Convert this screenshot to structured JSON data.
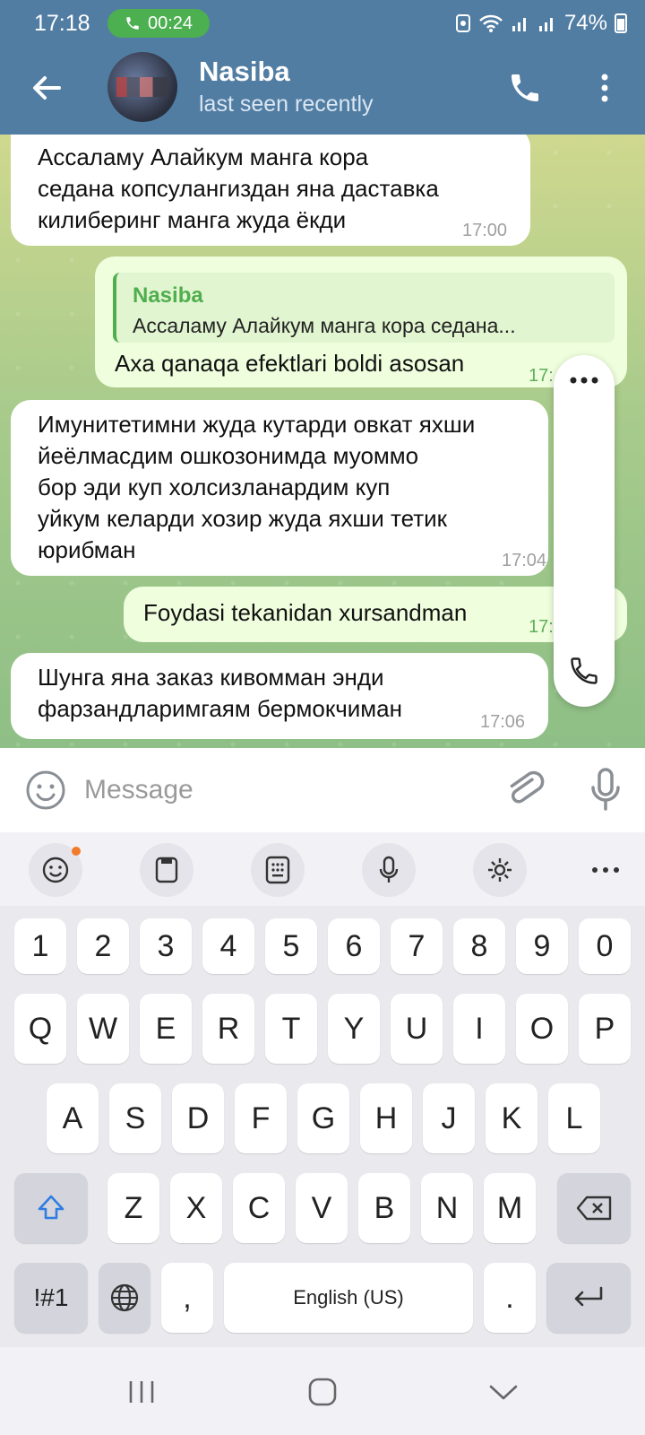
{
  "status_bar": {
    "time": "17:18",
    "call_duration": "00:24",
    "battery": "74%"
  },
  "header": {
    "name": "Nasiba",
    "status": "last seen recently",
    "accent": "#527da3"
  },
  "messages": [
    {
      "dir": "in",
      "lines": [
        "Ассаламу Алайкум манга кора",
        "седана копсулангиздан яна даставка",
        "килиберинг манга жуда ёкди"
      ],
      "time": "17:00"
    },
    {
      "dir": "out",
      "reply_name": "Nasiba",
      "reply_text": "Ассаламу Алайкум манга кора седана...",
      "lines": [
        "Axa qanaqa efektlari boldi asosan"
      ],
      "time": "17:"
    },
    {
      "dir": "in",
      "lines": [
        "Имунитетимни жуда кутарди овкат яхши",
        "йеёлмасдим ошкозонимда муоммо",
        "бор эди куп холсизланардим куп",
        "уйкум келарди хозир жуда яхши тетик",
        "юрибман"
      ],
      "time": "17:04"
    },
    {
      "dir": "out",
      "lines": [
        "Foydasi tekanidan xursandman"
      ],
      "time": "17:"
    },
    {
      "dir": "in",
      "lines": [
        "Шунга яна заказ кивомман энди",
        "фарзандларимгаям бермокчиман"
      ],
      "time": "17:06"
    }
  ],
  "composer": {
    "placeholder": "Message"
  },
  "keyboard": {
    "row_numbers": [
      "1",
      "2",
      "3",
      "4",
      "5",
      "6",
      "7",
      "8",
      "9",
      "0"
    ],
    "row_q": [
      "Q",
      "W",
      "E",
      "R",
      "T",
      "Y",
      "U",
      "I",
      "O",
      "P"
    ],
    "row_a": [
      "A",
      "S",
      "D",
      "F",
      "G",
      "H",
      "J",
      "K",
      "L"
    ],
    "row_z": [
      "Z",
      "X",
      "C",
      "V",
      "B",
      "N",
      "M"
    ],
    "symbols_label": "!#1",
    "comma": ",",
    "space_label": "English (US)",
    "period": "."
  }
}
